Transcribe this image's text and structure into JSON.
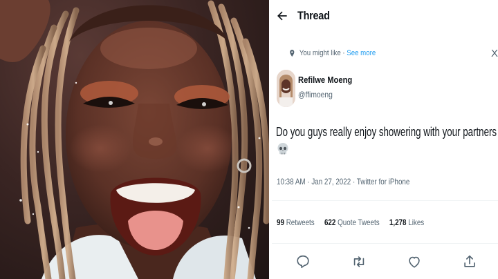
{
  "photo": {
    "description_icon": "selfie-photo"
  },
  "header": {
    "back_icon": "arrow-left-icon",
    "title": "Thread"
  },
  "suggestion": {
    "label": "You might like",
    "separator": "·",
    "link": "See more",
    "close": "X"
  },
  "author": {
    "name": "Refilwe Moeng",
    "handle": "@ffimoeng"
  },
  "tweet": {
    "text": "Do you guys really enjoy showering with your partners ?",
    "emoji_icon": "skull-emoji-icon"
  },
  "meta": {
    "time": "10:38 AM",
    "sep1": " · ",
    "date": "Jan 27, 2022",
    "sep2": " · ",
    "client": "Twitter for iPhone"
  },
  "stats": {
    "retweets_count": "99",
    "retweets_label": "Retweets",
    "quotes_count": "622",
    "quotes_label": "Quote Tweets",
    "likes_count": "1,278",
    "likes_label": "Likes"
  },
  "actions": [
    "reply-icon",
    "retweet-icon",
    "like-icon",
    "share-icon"
  ],
  "colors": {
    "link": "#1d9bf0",
    "secondary_text": "#536471",
    "primary_text": "#0f1419",
    "divider": "#eff3f4"
  }
}
